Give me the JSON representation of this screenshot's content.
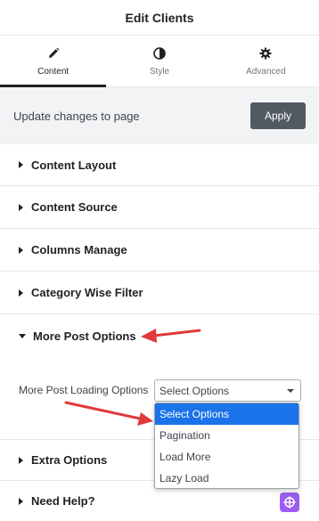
{
  "header": {
    "title": "Edit Clients"
  },
  "tabs": [
    {
      "label": "Content",
      "icon": "pencil-icon",
      "active": true
    },
    {
      "label": "Style",
      "icon": "half-circle-icon",
      "active": false
    },
    {
      "label": "Advanced",
      "icon": "gear-icon",
      "active": false
    }
  ],
  "update": {
    "text": "Update changes to page",
    "apply_label": "Apply"
  },
  "sections": {
    "content_layout": "Content Layout",
    "content_source": "Content Source",
    "columns_manage": "Columns Manage",
    "category_filter": "Category Wise Filter",
    "more_post": "More Post Options",
    "extra_options": "Extra Options",
    "need_help": "Need Help?"
  },
  "more_post": {
    "label": "More Post Loading Options",
    "selected": "Select Options",
    "options": [
      "Select Options",
      "Pagination",
      "Load More",
      "Lazy Load"
    ]
  },
  "colors": {
    "accent": "#1a73e8",
    "apply_button": "#515962",
    "annotation_arrow": "#e03a3a",
    "help_badge": "#9b5cf0"
  }
}
